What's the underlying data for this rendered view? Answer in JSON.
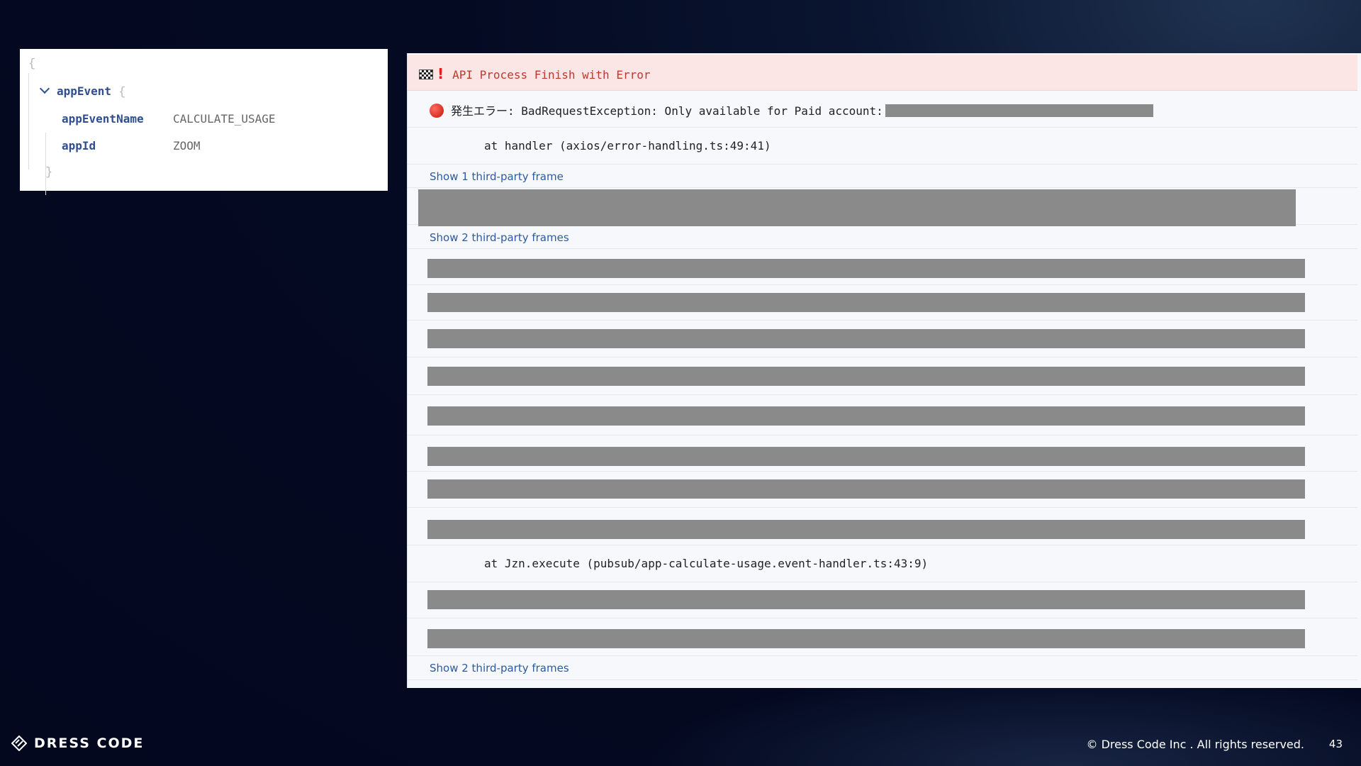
{
  "json_view": {
    "open_brace": "{",
    "key_app_event": "appEvent",
    "inner_open_brace": "{",
    "fields": [
      {
        "key": "appEventName",
        "value": "CALCULATE_USAGE"
      },
      {
        "key": "appId",
        "value": "ZOOM"
      }
    ],
    "inner_close_brace": "}"
  },
  "log": {
    "header": "API Process Finish with Error",
    "error_line": "発生エラー: BadRequestException: Only available for Paid account:",
    "stack_1": "at handler (axios/error-handling.ts:49:41)",
    "show_1_frame": "Show 1 third-party frame",
    "show_2_frames_a": "Show 2 third-party frames",
    "stack_2": "at Jzn.execute (pubsub/app-calculate-usage.event-handler.ts:43:9)",
    "show_2_frames_b": "Show 2 third-party frames"
  },
  "colors": {
    "header_bg": "#fbe5e5",
    "header_text": "#c0392b",
    "link": "#2c5aa0",
    "redaction": "#8a8a8a"
  },
  "footer": {
    "brand": "DRESS CODE",
    "copyright": "© Dress Code Inc . All rights reserved.",
    "page_number": "43"
  }
}
